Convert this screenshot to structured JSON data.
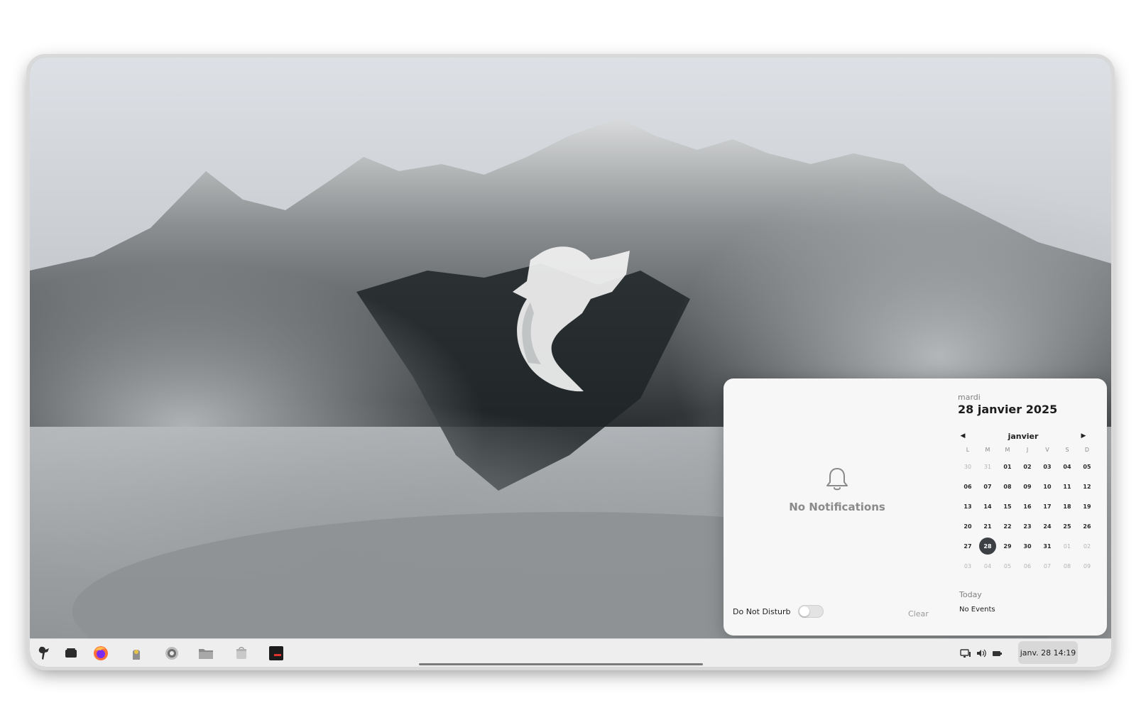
{
  "notifications": {
    "empty_text": "No Notifications",
    "dnd_label": "Do Not Disturb",
    "dnd_enabled": false,
    "clear_label": "Clear",
    "bell_icon": "bell-icon"
  },
  "calendar": {
    "weekday": "mardi",
    "full_date": "28 janvier 2025",
    "month": "janvier",
    "weekday_headers": [
      "L",
      "M",
      "M",
      "J",
      "V",
      "S",
      "D"
    ],
    "weeks": [
      [
        "30",
        "31",
        "01",
        "02",
        "03",
        "04",
        "05"
      ],
      [
        "06",
        "07",
        "08",
        "09",
        "10",
        "11",
        "12"
      ],
      [
        "13",
        "14",
        "15",
        "16",
        "17",
        "18",
        "19"
      ],
      [
        "20",
        "21",
        "22",
        "23",
        "24",
        "25",
        "26"
      ],
      [
        "27",
        "28",
        "29",
        "30",
        "31",
        "01",
        "02"
      ],
      [
        "03",
        "04",
        "05",
        "06",
        "07",
        "08",
        "09"
      ]
    ],
    "selected": "28",
    "events_heading": "Today",
    "events_text": "No Events"
  },
  "taskbar": {
    "launchers": [
      {
        "name": "app-menu-icon"
      },
      {
        "name": "window-overview-icon"
      },
      {
        "name": "firefox-icon"
      },
      {
        "name": "user-switch-icon"
      },
      {
        "name": "settings-icon"
      },
      {
        "name": "files-icon"
      },
      {
        "name": "software-store-icon"
      },
      {
        "name": "terminal-icon"
      }
    ],
    "tray": [
      {
        "name": "network-icon"
      },
      {
        "name": "volume-icon"
      },
      {
        "name": "battery-icon"
      }
    ],
    "clock": "janv. 28 14:19"
  },
  "colors": {
    "accent_today": "#3c3f43",
    "taskbar_bg": "#eeeeee",
    "panel_bg": "#f7f7f7"
  }
}
